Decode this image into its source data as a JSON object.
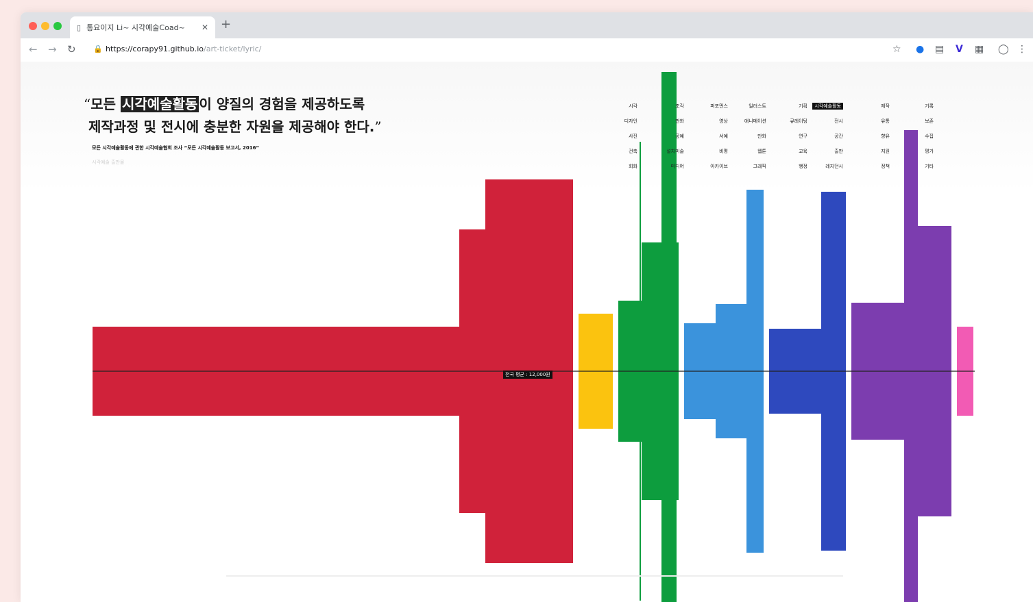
{
  "browser": {
    "tab_title": "통요이지 Li~ 시각예술Coad~",
    "tab_favicon": "document-icon",
    "url_host": "https://corapy91.github.io",
    "url_path": "/art-ticket/lyric/",
    "toolbar_icons": [
      "star-icon",
      "extension-blue-icon",
      "reader-icon",
      "v-extension-icon",
      "grid-icon",
      "profile-icon",
      "menu-icon"
    ]
  },
  "quote": {
    "open_mark": "“",
    "pre": "모든 ",
    "highlight": "시각예술활동",
    "line1_rest": "이 양질의 경험을 제공하도록",
    "line2": "제작과정 및 전시에 충분한 자원을 제공해야 한다.",
    "close_mark": "”",
    "citation": "모든 시각예술활동에 관한 시각예술협회 조사 “모든 시각예술활동 보고서, 2016”",
    "citation_sub": "시각예술 출판물"
  },
  "legend": {
    "columns": [
      [
        "시각",
        "디자인",
        "사진",
        "건축",
        "회화"
      ],
      [
        "조각",
        "판화",
        "공예",
        "설치미술",
        "미디어"
      ],
      [
        "퍼포먼스",
        "영상",
        "서예",
        "비평",
        "아카이브"
      ],
      [
        "일러스트",
        "애니메이션",
        "만화",
        "웹툰",
        "그래픽"
      ],
      [
        "기획",
        "큐레이팅",
        "연구",
        "교육",
        "행정"
      ],
      [
        "시각예술활동",
        "전시",
        "공간",
        "출판",
        "레지던시"
      ],
      [
        "제작",
        "유통",
        "향유",
        "지원",
        "정책"
      ],
      [
        "기록",
        "보존",
        "수집",
        "평가",
        "기타"
      ]
    ],
    "active": "시각예술활동"
  },
  "median_label": "전국 평균 : 12,000원",
  "chart_data": {
    "type": "bar",
    "baseline": 0,
    "series": [
      {
        "color": "#d0223a",
        "segments": [
          {
            "width": 535,
            "half_height": 65
          },
          {
            "width": 38,
            "half_height": 207
          },
          {
            "width": 128,
            "half_height": 280
          }
        ]
      },
      {
        "color": "#fbc30f",
        "segments": [
          {
            "width": 50,
            "half_height": 84
          }
        ]
      },
      {
        "color": "#0d9d3e",
        "segments": [
          {
            "width": 34,
            "half_height": 103
          },
          {
            "width": 54,
            "half_height": 188
          }
        ]
      },
      {
        "color": "#3b93dc",
        "segments": [
          {
            "width": 46,
            "half_height": 70
          },
          {
            "width": 45,
            "half_height": 98
          },
          {
            "width": 25,
            "half_height": 265
          }
        ]
      },
      {
        "color": "#2e49be",
        "segments": [
          {
            "width": 76,
            "half_height": 62
          },
          {
            "width": 36,
            "half_height": 262
          }
        ]
      },
      {
        "color": "#7c3daf",
        "segments": [
          {
            "width": 78,
            "half_height": 100
          },
          {
            "width": 68,
            "half_height": 212
          }
        ]
      },
      {
        "color": "#f25bb4",
        "segments": [
          {
            "width": 24,
            "half_height": 65
          }
        ]
      }
    ],
    "overlays": [
      {
        "color": "#0d9d3e",
        "width": 22,
        "top_offset": -437,
        "bottom_offset": 352
      },
      {
        "color": "#7c3daf",
        "width": 20,
        "top_offset": -352,
        "bottom_offset": 352
      },
      {
        "color": "#0d9d3e",
        "width": 2,
        "top_offset": -335,
        "bottom_offset": 335
      }
    ]
  }
}
